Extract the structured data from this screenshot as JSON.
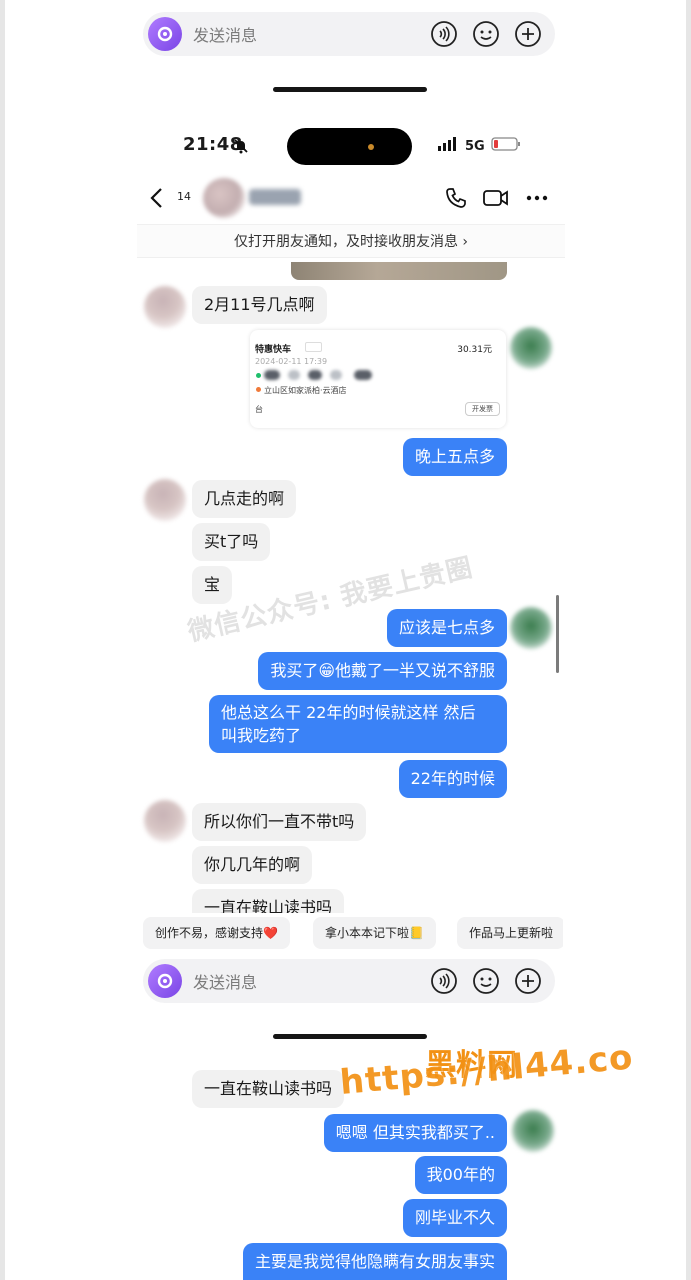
{
  "input_bar": {
    "placeholder": "发送消息"
  },
  "status": {
    "time": "21:48",
    "network": "5G"
  },
  "header": {
    "unread_count": "14",
    "notice": "仅打开朋友通知，及时接收朋友消息 ›"
  },
  "ride_card": {
    "title": "特惠快车",
    "price": "30.31元",
    "datetime": "2024-02-11 17:39",
    "address": "立山区如家派柏·云酒店",
    "footer": "台",
    "button": "开发票"
  },
  "messages": [
    {
      "dir": "in",
      "text": "2月11号几点啊"
    },
    {
      "dir": "out",
      "text": "晚上五点多"
    },
    {
      "dir": "in",
      "text": "几点走的啊"
    },
    {
      "dir": "in",
      "text": "买t了吗"
    },
    {
      "dir": "in",
      "text": "宝"
    },
    {
      "dir": "out",
      "text": "应该是七点多"
    },
    {
      "dir": "out",
      "text": "我买了😁他戴了一半又说不舒服"
    },
    {
      "dir": "out",
      "line1": "他总这么干 22年的时候就这样 然后",
      "line2": "叫我吃药了"
    },
    {
      "dir": "out",
      "text": "22年的时候"
    },
    {
      "dir": "in",
      "text": "所以你们一直不带t吗"
    },
    {
      "dir": "in",
      "text": "你几几年的啊"
    },
    {
      "dir": "in",
      "text": "一直在鞍山读书吗"
    }
  ],
  "watermark": "微信公众号: 我要上贵圈",
  "quick_replies": [
    "创作不易，感谢支持❤️",
    "拿小本本记下啦📒",
    "作品马上更新啦"
  ],
  "messages_lower": [
    {
      "dir": "in",
      "text": "一直在鞍山读书吗"
    },
    {
      "dir": "out",
      "text": "嗯嗯 但其实我都买了.."
    },
    {
      "dir": "out",
      "text": "我00年的"
    },
    {
      "dir": "out",
      "text": "刚毕业不久"
    },
    {
      "dir": "out",
      "text": "主要是我觉得他隐瞒有女朋友事实"
    }
  ],
  "overlay": {
    "line1": "黑料网",
    "line2": "https://hl44.co"
  },
  "colors": {
    "bubble_out": "#3a82f7",
    "bubble_in": "#f1f1f1",
    "overlay": "#f29114"
  }
}
